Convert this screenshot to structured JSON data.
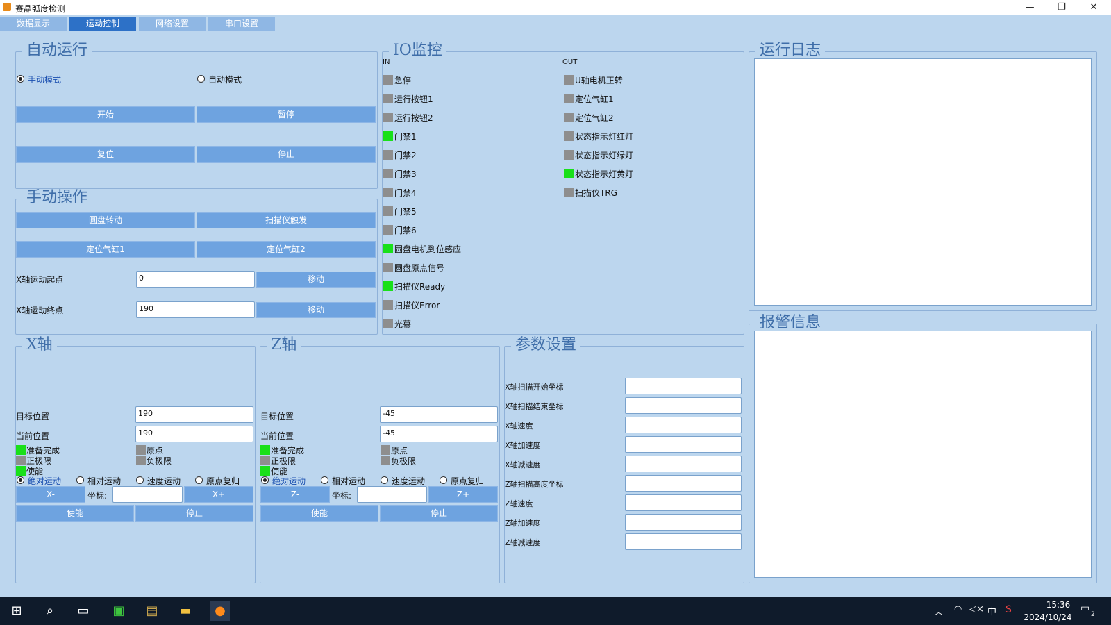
{
  "window": {
    "title": "赛晶弧度检测",
    "min": "—",
    "max": "❐",
    "close": "✕"
  },
  "tabs": [
    "数据显示",
    "运动控制",
    "网络设置",
    "串口设置"
  ],
  "auto_run": {
    "title": "自动运行",
    "manual_mode": "手动模式",
    "auto_mode": "自动模式",
    "start": "开始",
    "pause": "暂停",
    "reset": "复位",
    "stop": "停止"
  },
  "manual_op": {
    "title": "手动操作",
    "disk_rotate": "圆盘转动",
    "scanner_trigger": "扫描仪触发",
    "cyl1": "定位气缸1",
    "cyl2": "定位气缸2",
    "x_start_label": "X轴运动起点",
    "x_start_value": "0",
    "x_end_label": "X轴运动终点",
    "x_end_value": "190",
    "move": "移动"
  },
  "io": {
    "title": "IO监控",
    "in_label": "IN",
    "out_label": "OUT",
    "inputs": [
      {
        "label": "急停",
        "on": false
      },
      {
        "label": "运行按钮1",
        "on": false
      },
      {
        "label": "运行按钮2",
        "on": false
      },
      {
        "label": "门禁1",
        "on": true
      },
      {
        "label": "门禁2",
        "on": false
      },
      {
        "label": "门禁3",
        "on": false
      },
      {
        "label": "门禁4",
        "on": false
      },
      {
        "label": "门禁5",
        "on": false
      },
      {
        "label": "门禁6",
        "on": false
      },
      {
        "label": "圆盘电机到位感应",
        "on": true
      },
      {
        "label": "圆盘原点信号",
        "on": false
      },
      {
        "label": "扫描仪Ready",
        "on": true
      },
      {
        "label": "扫描仪Error",
        "on": false
      },
      {
        "label": "光幕",
        "on": false
      }
    ],
    "outputs": [
      {
        "label": "U轴电机正转",
        "on": false
      },
      {
        "label": "定位气缸1",
        "on": false
      },
      {
        "label": "定位气缸2",
        "on": false
      },
      {
        "label": "状态指示灯红灯",
        "on": false
      },
      {
        "label": "状态指示灯绿灯",
        "on": false
      },
      {
        "label": "状态指示灯黄灯",
        "on": true
      },
      {
        "label": "扫描仪TRG",
        "on": false
      }
    ]
  },
  "x_axis": {
    "title": "X轴",
    "target_label": "目标位置",
    "target": "190",
    "current_label": "当前位置",
    "current": "190",
    "ready": "准备完成",
    "origin": "原点",
    "pos_limit": "正极限",
    "neg_limit": "负极限",
    "enable_status": "使能",
    "modes": [
      "绝对运动",
      "相对运动",
      "速度运动",
      "原点复归"
    ],
    "minus": "X-",
    "plus": "X+",
    "coord_label": "坐标:",
    "enable": "使能",
    "stop": "停止"
  },
  "z_axis": {
    "title": "Z轴",
    "target_label": "目标位置",
    "target": "-45",
    "current_label": "当前位置",
    "current": "-45",
    "ready": "准备完成",
    "origin": "原点",
    "pos_limit": "正极限",
    "neg_limit": "负极限",
    "enable_status": "使能",
    "modes": [
      "绝对运动",
      "相对运动",
      "速度运动",
      "原点复归"
    ],
    "minus": "Z-",
    "plus": "Z+",
    "coord_label": "坐标:",
    "enable": "使能",
    "stop": "停止"
  },
  "params": {
    "title": "参数设置",
    "rows": [
      "X轴扫描开始坐标",
      "X轴扫描结束坐标",
      "X轴速度",
      "X轴加速度",
      "X轴减速度",
      "Z轴扫描高度坐标",
      "Z轴速度",
      "Z轴加速度",
      "Z轴减速度"
    ]
  },
  "log": {
    "title": "运行日志"
  },
  "alarm": {
    "title": "报警信息"
  },
  "taskbar": {
    "time": "15:36",
    "date": "2024/10/24",
    "ime": "中",
    "notify_count": "2"
  }
}
